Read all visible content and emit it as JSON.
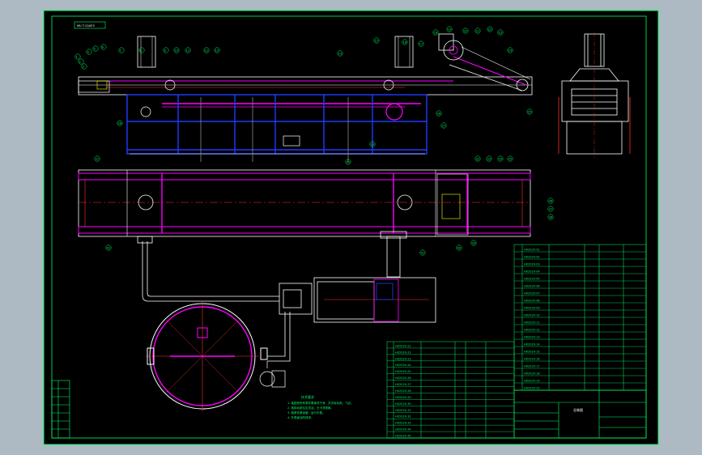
{
  "drawing": {
    "stamp_text": "MU T.CQUE3",
    "title_block": {
      "main_title": "总装图",
      "rows_right": [
        "HX2020-01",
        "HX2020-02",
        "HX2020-03",
        "HX2020-04",
        "HX2020-05",
        "HX2020-06",
        "HX2020-07",
        "HX2020-08",
        "HX2020-09",
        "HX2020-10",
        "HX2020-11",
        "HX2020-12",
        "HX2020-13",
        "HX2020-14",
        "HX2020-15",
        "HX2020-16",
        "HX2020-17",
        "HX2020-18",
        "HX2020-19",
        "HX2020-20"
      ],
      "rows_left": [
        "HX2020-21",
        "HX2020-22",
        "HX2020-23",
        "HX2020-24",
        "HX2020-25",
        "HX2020-26",
        "HX2020-27",
        "HX2020-28",
        "HX2020-29",
        "HX2020-30",
        "HX2020-31",
        "HX2020-32",
        "HX2020-33",
        "HX2020-34",
        "HX2020-35"
      ]
    },
    "tech_notes": {
      "heading": "技术要求",
      "lines": [
        "1. 装配前所有零件需清洗干净，并去除毛刺、飞边。",
        "2. 各转动部位应灵活，无卡滞现象。",
        "3. 链条张紧适度，运行平稳。",
        "4. 外表面涂防锈漆。"
      ]
    },
    "balloons_top": [
      "1",
      "2",
      "3",
      "4",
      "5",
      "6",
      "7",
      "8",
      "9",
      "10",
      "11",
      "12",
      "13",
      "14",
      "15",
      "16",
      "17",
      "18",
      "19",
      "20",
      "21",
      "22",
      "23",
      "24",
      "25",
      "26",
      "27",
      "28",
      "29",
      "30"
    ],
    "balloons_mid": [
      "31",
      "32",
      "33",
      "34",
      "35",
      "36",
      "37",
      "38",
      "39",
      "40",
      "41",
      "42"
    ]
  },
  "colors": {
    "frame": "#00ff66",
    "bg": "#000000",
    "outer": "#adb9c3",
    "white": "#ffffff",
    "magenta": "#ff00ff",
    "red": "#ff3030",
    "blue": "#1c3cff",
    "yellow": "#ffff00",
    "cyan": "#00ffff"
  }
}
